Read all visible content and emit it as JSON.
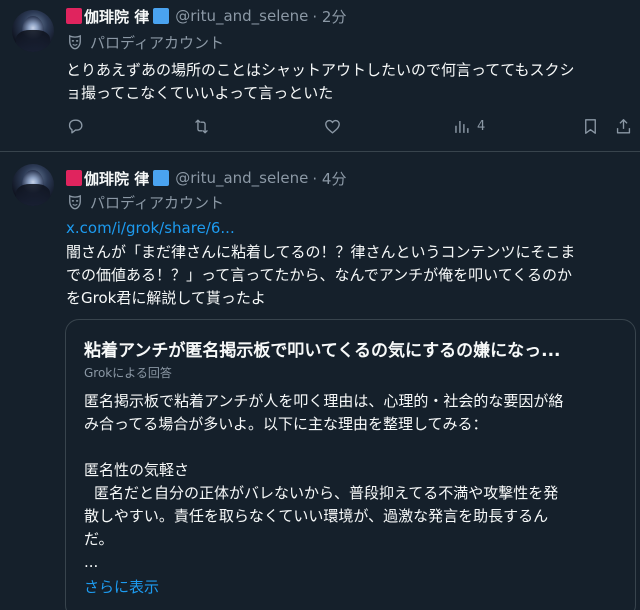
{
  "posts": [
    {
      "author": {
        "name": "伽琲院 律",
        "handle": "@ritu_and_selene",
        "time": "· 2分"
      },
      "parody_label": "パロディアカウント",
      "text_lines": [
        "とりあえずあの場所のことはシャットアウトしたいので何言っててもスクシ",
        "ョ撮ってこなくていいよって言っといた"
      ],
      "actions": {
        "views": "4"
      }
    },
    {
      "author": {
        "name": "伽琲院 律",
        "handle": "@ritu_and_selene",
        "time": "· 4分"
      },
      "parody_label": "パロディアカウント",
      "link": "x.com/i/grok/share/6...",
      "text_lines": [
        "闇さんが「まだ律さんに粘着してるの！？律さんというコンテンツにそこま",
        "での価値ある！？」って言ってたから、なんでアンチが俺を叩いてくるのか",
        "をGrok君に解説して貰ったよ"
      ],
      "card": {
        "title": "粘着アンチが匿名掲示板で叩いてくるの気にするの嫌になっ...",
        "subtitle": "Grokによる回答",
        "body_lines": [
          "匿名掲示板で粘着アンチが人を叩く理由は、心理的・社会的な要因が絡",
          "み合ってる場合が多いよ。以下に主な理由を整理してみる：",
          "",
          "匿名性の気軽さ",
          "匿名だと自分の正体がバレないから、普段抑えてる不満や攻撃性を発",
          "散しやすい。責任を取らなくていい環境が、過激な発言を助長するん",
          "だ。",
          "..."
        ],
        "more": "さらに表示"
      }
    }
  ],
  "icons": [
    "reply-icon",
    "repost-icon",
    "like-icon",
    "views-icon",
    "bookmark-icon",
    "share-icon",
    "parody-mask-icon"
  ],
  "colors": {
    "background": "#15202b",
    "text": "#f7f9f9",
    "secondary": "#8b98a5",
    "link": "#1d9bf0",
    "border": "#38444d"
  }
}
